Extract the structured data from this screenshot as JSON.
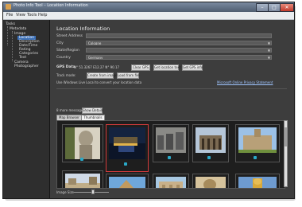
{
  "window": {
    "title": "Photo Info Tool – Location Information"
  },
  "menu": [
    "File",
    "View",
    "Tools",
    "Help"
  ],
  "sidebar": {
    "tree": [
      {
        "label": "Tasks",
        "level": 0
      },
      {
        "label": "Metadata",
        "level": 1
      },
      {
        "label": "Image",
        "level": 2
      },
      {
        "label": "Location",
        "level": 3,
        "selected": true
      },
      {
        "label": "Description",
        "level": 3
      },
      {
        "label": "Date/Time",
        "level": 3
      },
      {
        "label": "Rating",
        "level": 3
      },
      {
        "label": "Categories",
        "level": 3
      },
      {
        "label": "Text",
        "level": 3
      },
      {
        "label": "Camera",
        "level": 1
      },
      {
        "label": "Photographer",
        "level": 1
      }
    ]
  },
  "location": {
    "title": "Location Information",
    "fields": [
      {
        "label": "Street Address",
        "value": ""
      },
      {
        "label": "City",
        "value": "Cologne",
        "dropdown": true
      },
      {
        "label": "State/Region",
        "value": "",
        "dropdown": true
      },
      {
        "label": "Country",
        "value": "Germany",
        "dropdown": true
      }
    ]
  },
  "gps": {
    "label": "GPS Data",
    "value": "N° 51.3267 E12.27 N° 90.17",
    "clear_label": "Clear GPS",
    "get_location_text_label": "Get location text",
    "get_gps_info_label": "Get GPS info"
  },
  "track": {
    "label": "Track mode:",
    "create_from_images_label": "Create from images",
    "load_from_file_label": "Load from file",
    "note": "Use Windows Live Local to convert your location data",
    "privacy_link": "Microsoft Online Privacy Statement"
  },
  "images": {
    "count_label": "8 more messages",
    "show_details_label": "Show Details",
    "tabs": [
      "Map Browser",
      "Thumbnails"
    ],
    "active_tab": 1,
    "thumbnails": [
      {
        "name": "statue-photo",
        "selected": false,
        "checked": true
      },
      {
        "name": "night-harbor-photo",
        "selected": true,
        "checked": true
      },
      {
        "name": "memorial-photo",
        "selected": false,
        "checked": true
      },
      {
        "name": "gate-photo",
        "selected": false,
        "checked": true
      },
      {
        "name": "cathedral-photo",
        "selected": false,
        "checked": true
      },
      {
        "name": "street-photo",
        "selected": false,
        "checked": false
      },
      {
        "name": "pyramid-photo",
        "selected": false,
        "checked": false
      },
      {
        "name": "temple-photo",
        "selected": false,
        "checked": false
      },
      {
        "name": "sphinx-photo",
        "selected": false,
        "checked": false
      },
      {
        "name": "golden-statue-photo",
        "selected": false,
        "checked": false
      }
    ],
    "size_label": "Image Size"
  },
  "colors": {
    "accent": "#3b6fb6",
    "selection_border": "#d23b3b",
    "check_mark": "#2aa9c8"
  },
  "icons": {
    "close": "close-icon",
    "minimize": "minimize-icon",
    "maximize": "maximize-icon",
    "app": "app-icon"
  }
}
